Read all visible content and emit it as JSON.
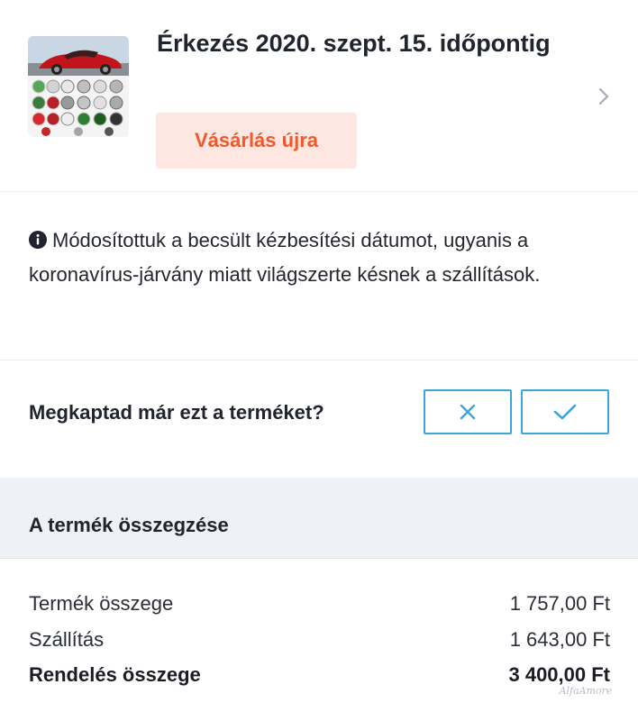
{
  "order": {
    "arrival_title": "Érkezés 2020. szept. 15. időpontig",
    "rebuy_label": "Vásárlás újra",
    "thumbnail_icon": "product-thumbnail",
    "detail_icon": "chevron-right-icon"
  },
  "notice": {
    "icon": "info-icon",
    "text": "Módosítottuk a becsült kézbesítési dátumot, ugyanis a koronavírus-járvány miatt világszerte késnek a szállítások."
  },
  "received": {
    "question": "Megkaptad már ezt a terméket?",
    "no_icon": "close-icon",
    "yes_icon": "check-icon"
  },
  "summary": {
    "title": "A termék összegzése",
    "rows": [
      {
        "label": "Termék összege",
        "value": "1 757,00 Ft"
      },
      {
        "label": "Szállítás",
        "value": "1 643,00 Ft"
      },
      {
        "label": "Rendelés összege",
        "value": "3 400,00 Ft"
      }
    ]
  },
  "watermark": "AlfaAmore",
  "colors": {
    "accent_orange": "#f0592b",
    "rebuy_bg": "#fde7e0",
    "answer_blue": "#3fa5d6",
    "summary_bg": "#eef2f6"
  }
}
